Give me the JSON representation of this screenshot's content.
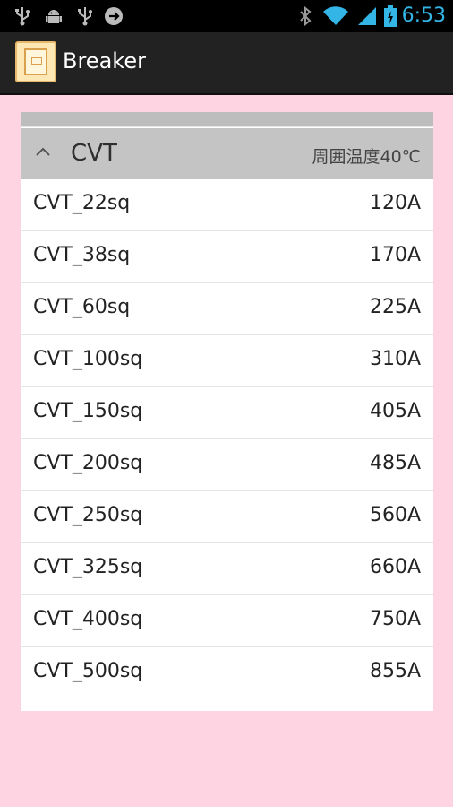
{
  "status_bar": {
    "time": "6:53",
    "left_icons": [
      "usb-icon",
      "android-debug-icon",
      "usb-icon",
      "headset-icon"
    ],
    "right_icons": [
      "bluetooth-icon",
      "wifi-icon",
      "signal-icon",
      "battery-icon"
    ],
    "accent_color": "#33b5e5"
  },
  "action_bar": {
    "title": "Breaker",
    "app_icon": "breaker-app-icon"
  },
  "group": {
    "title": "CVT",
    "subtitle": "周囲温度40℃",
    "expand_icon": "chevron-up-icon"
  },
  "rows": [
    {
      "name": "CVT_22sq",
      "value": "120A"
    },
    {
      "name": "CVT_38sq",
      "value": "170A"
    },
    {
      "name": "CVT_60sq",
      "value": "225A"
    },
    {
      "name": "CVT_100sq",
      "value": "310A"
    },
    {
      "name": "CVT_150sq",
      "value": "405A"
    },
    {
      "name": "CVT_200sq",
      "value": "485A"
    },
    {
      "name": "CVT_250sq",
      "value": "560A"
    },
    {
      "name": "CVT_325sq",
      "value": "660A"
    },
    {
      "name": "CVT_400sq",
      "value": "750A"
    },
    {
      "name": "CVT_500sq",
      "value": "855A"
    }
  ],
  "colors": {
    "background": "#ffd4e2",
    "action_bar": "#222222",
    "group_header": "#c4c4c4"
  }
}
